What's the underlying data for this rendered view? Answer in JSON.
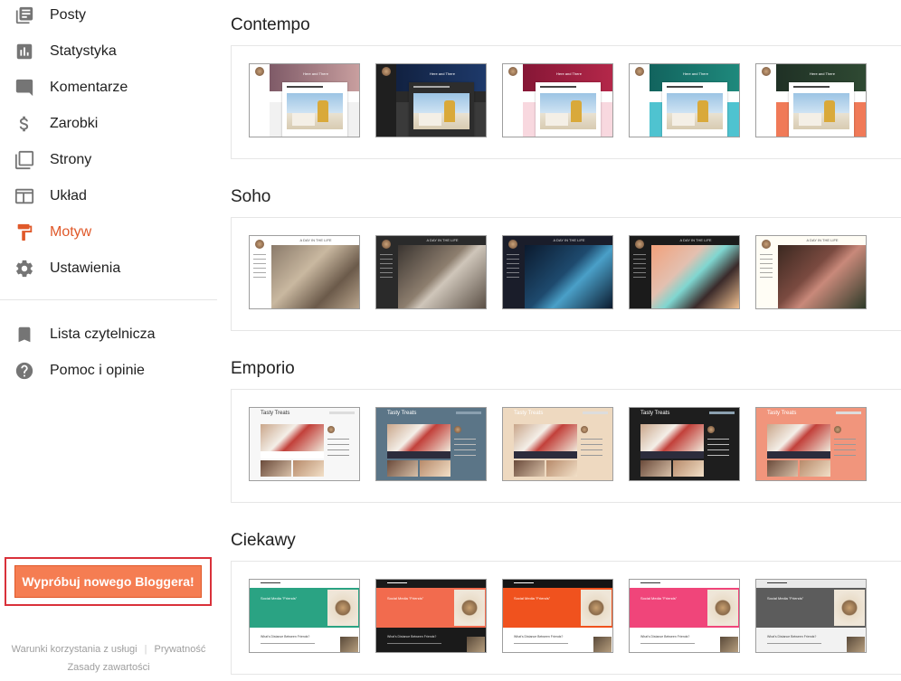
{
  "sidebar": {
    "items": [
      {
        "label": "Posty",
        "icon": "posts-icon"
      },
      {
        "label": "Statystyka",
        "icon": "stats-icon"
      },
      {
        "label": "Komentarze",
        "icon": "comments-icon"
      },
      {
        "label": "Zarobki",
        "icon": "dollar-icon"
      },
      {
        "label": "Strony",
        "icon": "pages-icon"
      },
      {
        "label": "Układ",
        "icon": "layout-icon"
      },
      {
        "label": "Motyw",
        "icon": "theme-paint-roller-icon",
        "active": true
      },
      {
        "label": "Ustawienia",
        "icon": "gear-icon"
      }
    ],
    "secondary": [
      {
        "label": "Lista czytelnicza",
        "icon": "bookmark-icon"
      },
      {
        "label": "Pomoc i opinie",
        "icon": "help-icon"
      }
    ],
    "cta_label": "Wypróbuj nowego Bloggera!",
    "footer": {
      "terms": "Warunki korzystania z usługi",
      "privacy": "Prywatność",
      "content_policy": "Zasady zawartości"
    }
  },
  "colors": {
    "accent": "#e0592a",
    "cta_bg": "#f57d52",
    "cta_frame": "#d9313a"
  },
  "themes": [
    {
      "name": "Contempo",
      "thumb_title": "Here and There",
      "variants": [
        "light",
        "dark",
        "rose",
        "teal",
        "coral"
      ]
    },
    {
      "name": "Soho",
      "thumb_title": "A DAY IN THE LIFE",
      "variants": [
        "cat",
        "interior",
        "space",
        "cosmetics",
        "food"
      ]
    },
    {
      "name": "Emporio",
      "thumb_title": "Tasty Treats",
      "variants": [
        "white",
        "slate",
        "beige",
        "black",
        "salmon"
      ]
    },
    {
      "name": "Ciekawy",
      "thumb_title": "Social Media \"Friends\"",
      "thumb_subtitle": "What's Distance Between Friends?",
      "variants": [
        "green",
        "black",
        "orange",
        "pink",
        "gray"
      ]
    }
  ]
}
